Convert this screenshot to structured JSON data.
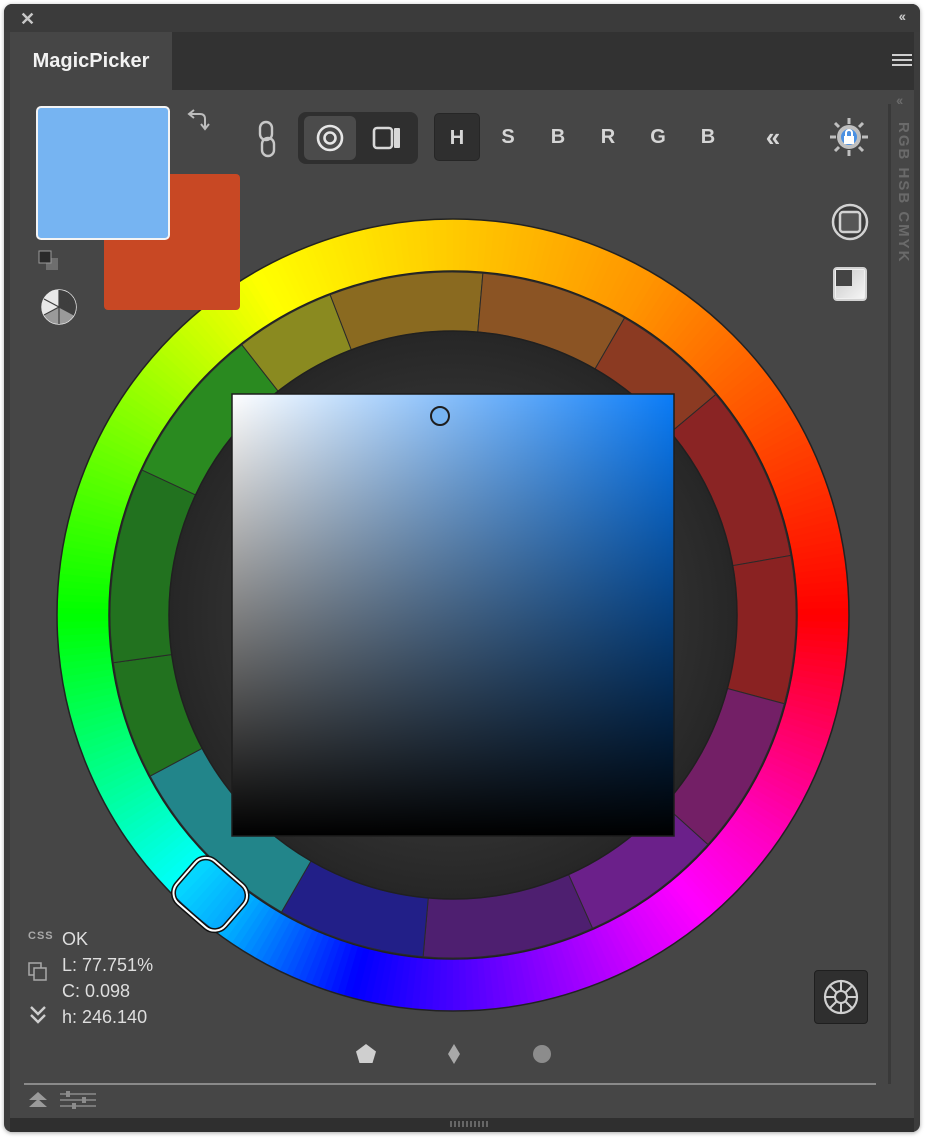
{
  "window": {
    "close_glyph": "✕",
    "collapse_glyph": "‹‹",
    "tab_title": "MagicPicker"
  },
  "colors": {
    "foreground_swatch": "#76b4f2",
    "background_swatch": "#c84824",
    "accent": "#4a90e2"
  },
  "toolbar": {
    "modes": [
      "H",
      "S",
      "B",
      "R",
      "G",
      "B"
    ],
    "active_mode": "H",
    "collapse_glyph": "«"
  },
  "side_panel": {
    "vertical_labels": "RGB HSB CMYK"
  },
  "readout": {
    "css_label": "CSS",
    "status": "OK",
    "l_value": "L: 77.751%",
    "c_value": "C: 0.098",
    "h_value": "h: 246.140"
  },
  "icons": {
    "close": "close-icon",
    "collapse": "collapse-icon",
    "panel_menu": "menu-icon",
    "swap": "swap-arrow-icon",
    "default_colors": "default-colors-icon",
    "harmony": "harmony-icon",
    "link": "link-icon",
    "ring_mode": "ring-icon",
    "square_mode": "square-icon",
    "settings": "gear-lock-icon",
    "shape_square": "shape-square-icon",
    "shape_corner": "shape-corner-icon",
    "wheel_settings": "wheel-icon",
    "pentagon": "pentagon-icon",
    "diamond": "diamond-icon",
    "circle": "circle-icon"
  },
  "wheel": {
    "selected_hue": 246.14
  }
}
